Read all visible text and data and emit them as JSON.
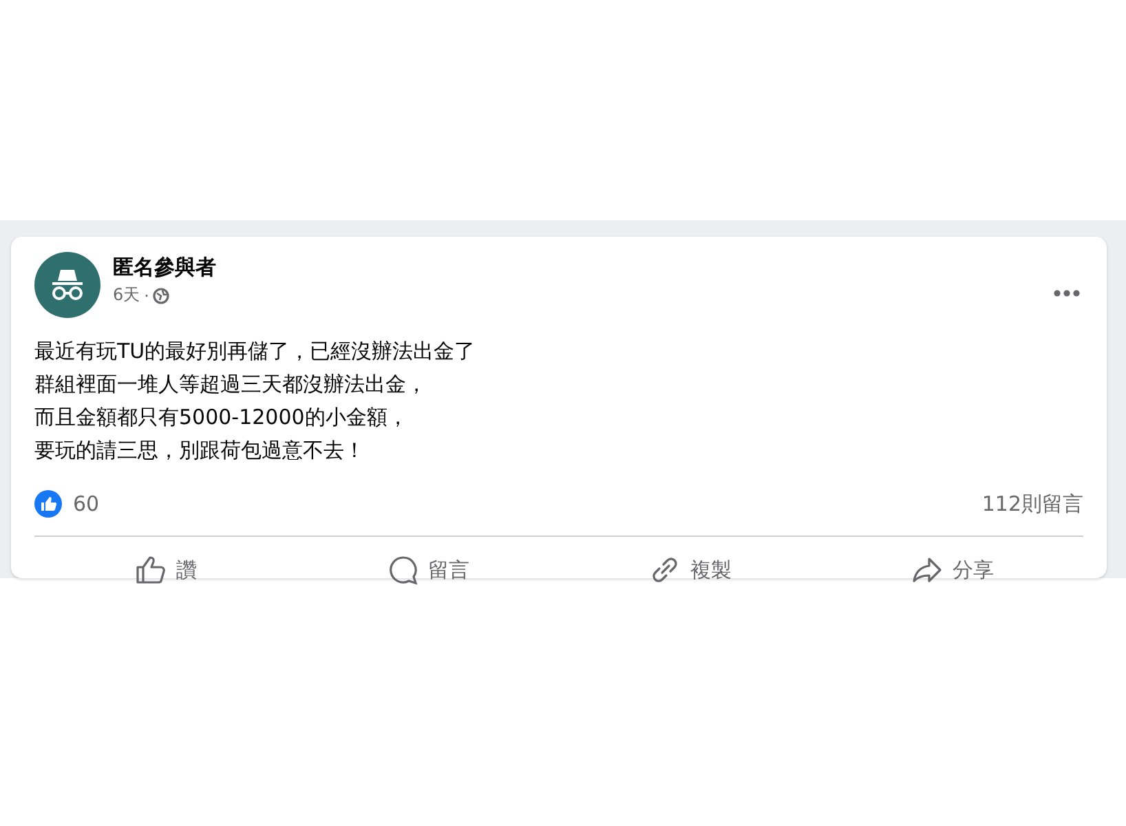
{
  "post": {
    "author": "匿名參與者",
    "time": "6天",
    "separator": "·",
    "lines": [
      "最近有玩TU的最好別再儲了，已經沒辦法出金了",
      "群組裡面一堆人等超過三天都沒辦法出金，",
      "而且金額都只有5000-12000的小金額，",
      "要玩的請三思，別跟荷包過意不去！"
    ],
    "reactions_count": "60",
    "comments_count": "112則留言",
    "actions": [
      {
        "kind": "like",
        "label": "讚"
      },
      {
        "kind": "comment",
        "label": "留言"
      },
      {
        "kind": "copy",
        "label": "複製"
      },
      {
        "kind": "share",
        "label": "分享"
      }
    ]
  }
}
